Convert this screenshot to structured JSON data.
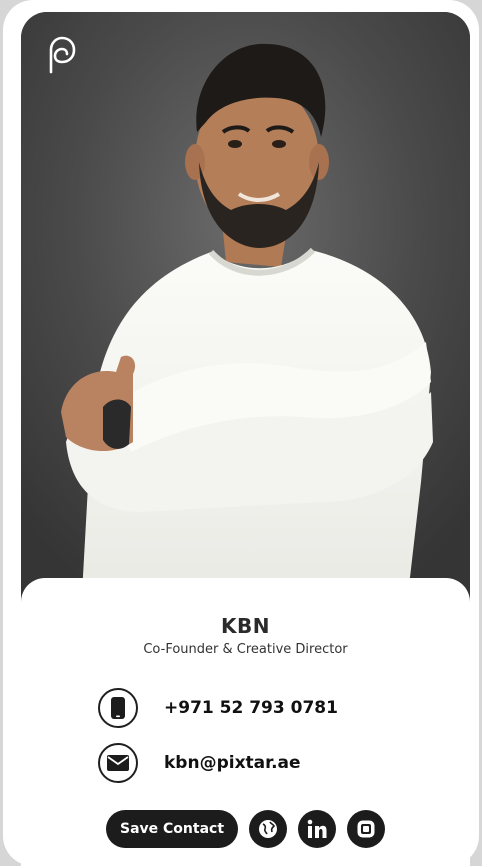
{
  "profile": {
    "name": "KBN",
    "title": "Co-Founder & Creative Director",
    "photo_icon": "person-portrait",
    "logo_icon": "pixtar-logo-icon"
  },
  "contacts": {
    "phone": "+971 52 793 0781",
    "email": "kbn@pixtar.ae",
    "phone_icon": "phone-icon",
    "email_icon": "mail-icon"
  },
  "actions": {
    "save_label": "Save Contact",
    "website_icon": "globe-icon",
    "linkedin_icon": "linkedin-icon",
    "instagram_icon": "instagram-icon"
  },
  "colors": {
    "dark": "#1c1c1c",
    "background": "#ffffff",
    "photo_backdrop": "#4b4b4b"
  }
}
